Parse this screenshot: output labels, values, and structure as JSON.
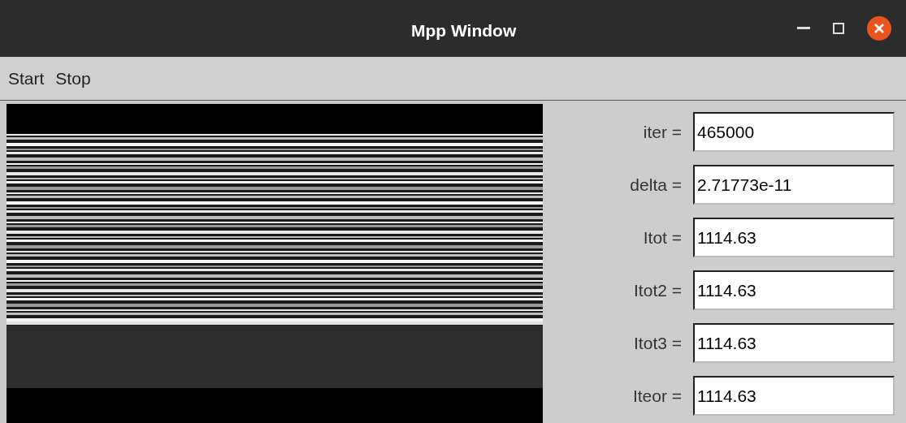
{
  "window": {
    "title": "Mpp Window"
  },
  "menu": [
    {
      "label": "Start"
    },
    {
      "label": "Stop"
    }
  ],
  "fields": [
    {
      "label": "iter =",
      "value": "465000"
    },
    {
      "label": "delta =",
      "value": "2.71773e-11"
    },
    {
      "label": "Itot =",
      "value": "1114.63"
    },
    {
      "label": "Itot2 =",
      "value": "1114.63"
    },
    {
      "label": "Itot3 =",
      "value": "1114.63"
    },
    {
      "label": "Iteor =",
      "value": "1114.63"
    }
  ]
}
